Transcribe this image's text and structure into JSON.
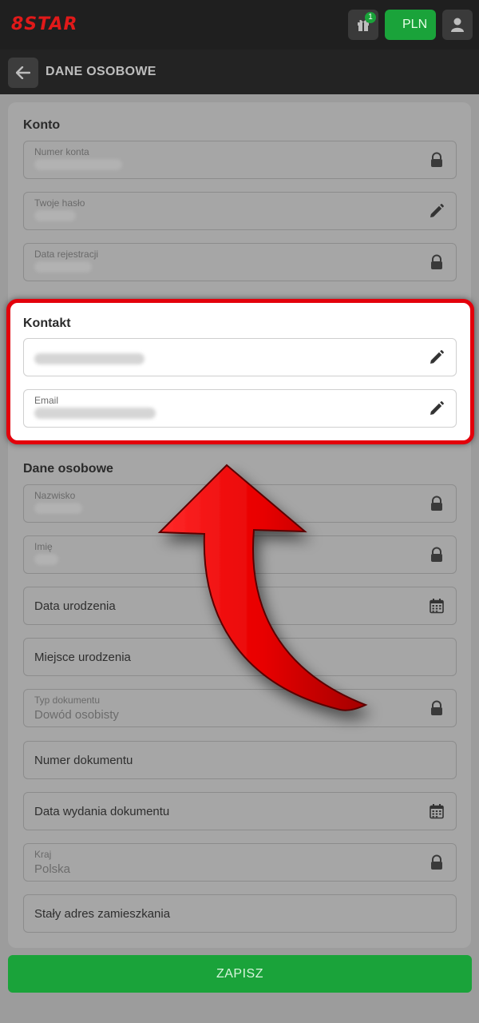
{
  "header": {
    "logo_text": "8STAR",
    "gift_badge": "1",
    "currency": "PLN"
  },
  "subheader": {
    "title": "DANE OSOBOWE"
  },
  "sections": {
    "konto": {
      "title": "Konto",
      "fields": [
        {
          "label": "Numer konta",
          "icon": "lock-icon"
        },
        {
          "label": "Twoje hasło",
          "icon": "pencil-icon"
        },
        {
          "label": "Data rejestracji",
          "icon": "lock-icon"
        }
      ]
    },
    "kontakt": {
      "title": "Kontakt",
      "fields": [
        {
          "label": "",
          "icon": "pencil-icon"
        },
        {
          "label": "Email",
          "icon": "pencil-icon"
        }
      ]
    },
    "dane": {
      "title": "Dane osobowe",
      "fields": [
        {
          "label": "Nazwisko",
          "value": "",
          "icon": "lock-icon"
        },
        {
          "label": "Imię",
          "value": "",
          "icon": "lock-icon"
        },
        {
          "placeholder": "Data urodzenia",
          "icon": "calendar-icon"
        },
        {
          "placeholder": "Miejsce urodzenia"
        },
        {
          "label": "Typ dokumentu",
          "value": "Dowód osobisty",
          "icon": "lock-icon"
        },
        {
          "placeholder": "Numer dokumentu"
        },
        {
          "placeholder": "Data wydania dokumentu",
          "icon": "calendar-icon"
        },
        {
          "label": "Kraj",
          "value": "Polska",
          "icon": "lock-icon"
        },
        {
          "placeholder": "Stały adres zamieszkania"
        }
      ]
    }
  },
  "save_button": "ZAPISZ",
  "colors": {
    "accent_green": "#1aa33a",
    "highlight_red": "#e3000b"
  }
}
